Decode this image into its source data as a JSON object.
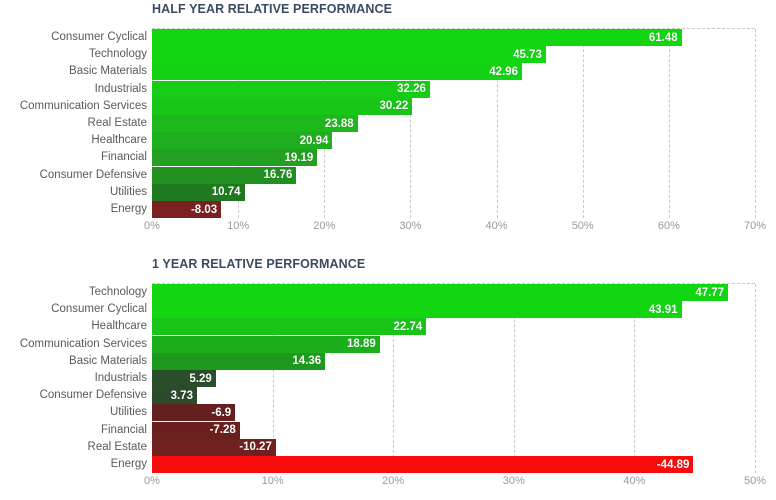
{
  "charts": [
    {
      "id": "half-year",
      "title": "HALF YEAR RELATIVE PERFORMANCE",
      "chart_data": {
        "type": "bar",
        "title": "HALF YEAR RELATIVE PERFORMANCE",
        "orientation": "horizontal",
        "xlabel": "",
        "ylabel": "",
        "xlim": [
          0,
          70
        ],
        "xticks": [
          "0%",
          "10%",
          "20%",
          "30%",
          "40%",
          "50%",
          "60%",
          "70%"
        ],
        "xtick_values": [
          0,
          10,
          20,
          30,
          40,
          50,
          60,
          70
        ],
        "grid": true,
        "legend": "none",
        "categories": [
          "Consumer Cyclical",
          "Technology",
          "Basic Materials",
          "Industrials",
          "Communication Services",
          "Real Estate",
          "Healthcare",
          "Financial",
          "Consumer Defensive",
          "Utilities",
          "Energy"
        ],
        "values": [
          61.48,
          45.73,
          42.96,
          32.26,
          30.22,
          23.88,
          20.94,
          19.19,
          16.76,
          10.74,
          -8.03
        ],
        "labels": [
          "61.48",
          "45.73",
          "42.96",
          "32.26",
          "30.22",
          "23.88",
          "20.94",
          "19.19",
          "16.76",
          "10.74",
          "-8.03"
        ],
        "bar_colors": [
          "#12d612",
          "#12d612",
          "#14d214",
          "#16cc16",
          "#18c618",
          "#1cb81c",
          "#1fae1f",
          "#22a022",
          "#219021",
          "#1f7a1f",
          "#7a2020"
        ]
      }
    },
    {
      "id": "one-year",
      "title": "1 YEAR RELATIVE PERFORMANCE",
      "chart_data": {
        "type": "bar",
        "title": "1 YEAR RELATIVE PERFORMANCE",
        "orientation": "horizontal",
        "xlabel": "",
        "ylabel": "",
        "xlim": [
          0,
          50
        ],
        "xticks": [
          "0%",
          "10%",
          "20%",
          "30%",
          "40%",
          "50%"
        ],
        "xtick_values": [
          0,
          10,
          20,
          30,
          40,
          50
        ],
        "grid": true,
        "legend": "none",
        "categories": [
          "Technology",
          "Consumer Cyclical",
          "Healthcare",
          "Communication Services",
          "Basic Materials",
          "Industrials",
          "Consumer Defensive",
          "Utilities",
          "Financial",
          "Real Estate",
          "Energy"
        ],
        "values": [
          47.77,
          43.91,
          22.74,
          18.89,
          14.36,
          5.29,
          3.73,
          -6.9,
          -7.28,
          -10.27,
          -44.89
        ],
        "labels": [
          "47.77",
          "43.91",
          "22.74",
          "18.89",
          "14.36",
          "5.29",
          "3.73",
          "-6.9",
          "-7.28",
          "-10.27",
          "-44.89"
        ],
        "bar_colors": [
          "#12d612",
          "#12d612",
          "#17c417",
          "#1bb01b",
          "#1d9a1d",
          "#2a4d2a",
          "#2d4a2d",
          "#64201f",
          "#6a201f",
          "#70201f",
          "#f80c0c"
        ]
      }
    }
  ],
  "colors": {
    "title": "#3b4a63",
    "category_label": "#5a5a5a",
    "tick_label": "#999999",
    "gridline": "#c9c9c9",
    "bar_value_text": "#ffffff",
    "positive_bright": "#12d612",
    "negative_bright": "#f80c0c",
    "background": "#ffffff"
  }
}
